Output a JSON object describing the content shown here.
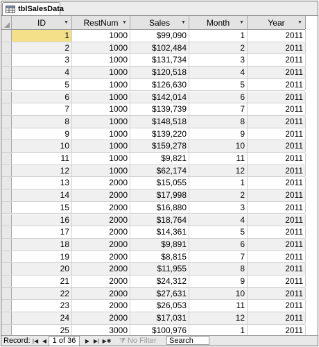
{
  "tab": {
    "title": "tblSalesData",
    "icon": "table-icon"
  },
  "columns": [
    "ID",
    "RestNum",
    "Sales",
    "Month",
    "Year"
  ],
  "rows": [
    [
      "1",
      "1000",
      "$99,090",
      "1",
      "2011"
    ],
    [
      "2",
      "1000",
      "$102,484",
      "2",
      "2011"
    ],
    [
      "3",
      "1000",
      "$131,734",
      "3",
      "2011"
    ],
    [
      "4",
      "1000",
      "$120,518",
      "4",
      "2011"
    ],
    [
      "5",
      "1000",
      "$126,630",
      "5",
      "2011"
    ],
    [
      "6",
      "1000",
      "$142,014",
      "6",
      "2011"
    ],
    [
      "7",
      "1000",
      "$139,739",
      "7",
      "2011"
    ],
    [
      "8",
      "1000",
      "$148,518",
      "8",
      "2011"
    ],
    [
      "9",
      "1000",
      "$139,220",
      "9",
      "2011"
    ],
    [
      "10",
      "1000",
      "$159,278",
      "10",
      "2011"
    ],
    [
      "11",
      "1000",
      "$9,821",
      "11",
      "2011"
    ],
    [
      "12",
      "1000",
      "$62,174",
      "12",
      "2011"
    ],
    [
      "13",
      "2000",
      "$15,055",
      "1",
      "2011"
    ],
    [
      "14",
      "2000",
      "$17,998",
      "2",
      "2011"
    ],
    [
      "15",
      "2000",
      "$16,880",
      "3",
      "2011"
    ],
    [
      "16",
      "2000",
      "$18,764",
      "4",
      "2011"
    ],
    [
      "17",
      "2000",
      "$14,361",
      "5",
      "2011"
    ],
    [
      "18",
      "2000",
      "$9,891",
      "6",
      "2011"
    ],
    [
      "19",
      "2000",
      "$8,815",
      "7",
      "2011"
    ],
    [
      "20",
      "2000",
      "$11,955",
      "8",
      "2011"
    ],
    [
      "21",
      "2000",
      "$24,312",
      "9",
      "2011"
    ],
    [
      "22",
      "2000",
      "$27,631",
      "10",
      "2011"
    ],
    [
      "23",
      "2000",
      "$26,053",
      "11",
      "2011"
    ],
    [
      "24",
      "2000",
      "$17,031",
      "12",
      "2011"
    ],
    [
      "25",
      "3000",
      "$100,976",
      "1",
      "2011"
    ]
  ],
  "nav": {
    "record_label": "Record:",
    "position": "1 of 36",
    "filter_label": "No Filter",
    "search_label": "Search"
  },
  "colors": {
    "selected_row": "#f5e08a",
    "alt_row": "#f0f0f0",
    "header": "#e3e3e3"
  }
}
